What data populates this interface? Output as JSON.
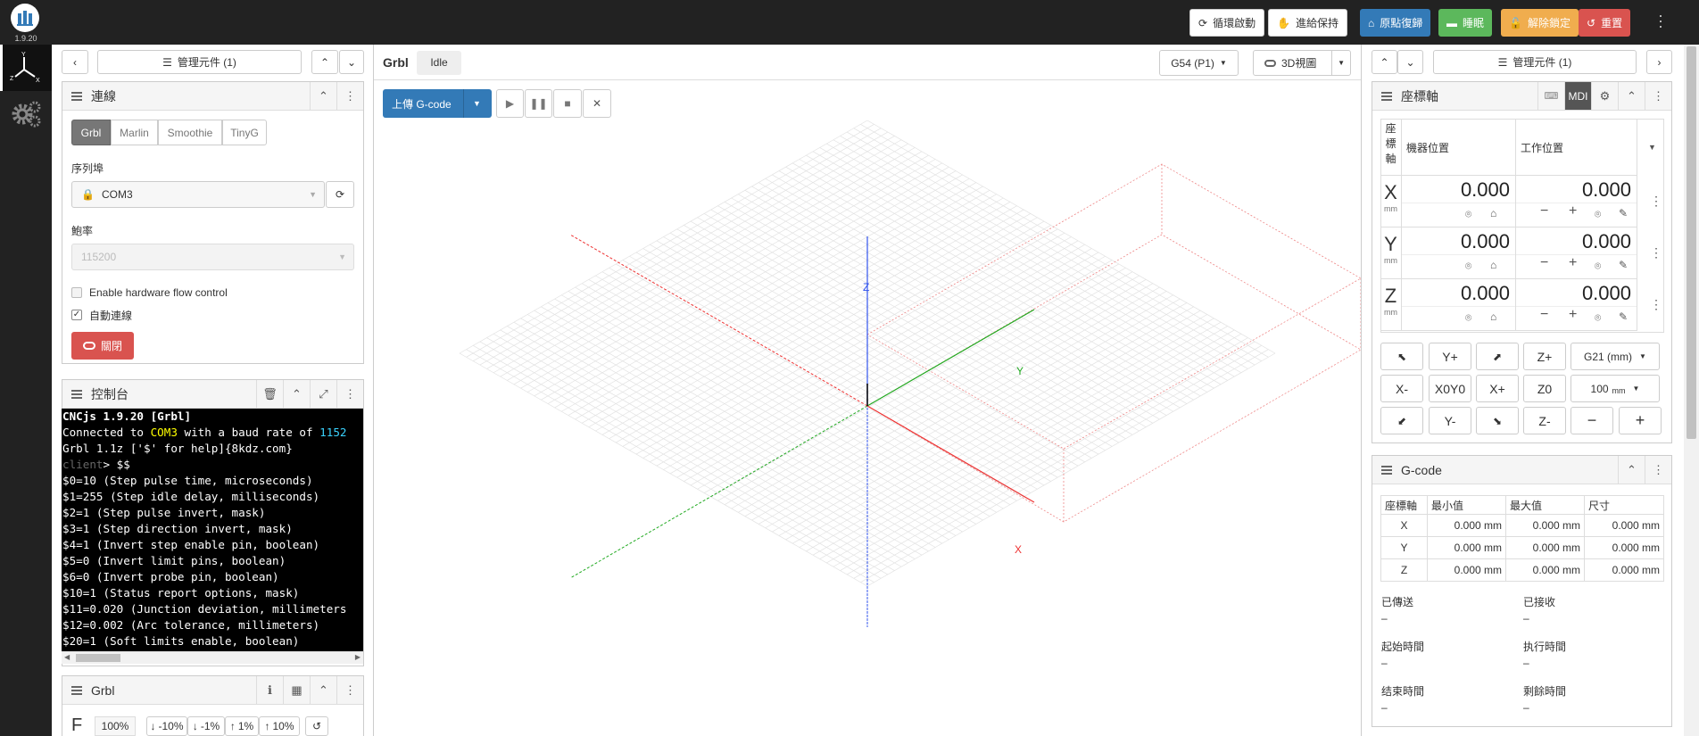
{
  "app": {
    "version": "1.9.20"
  },
  "topbar": {
    "cycle_start": "循環啟動",
    "feed_hold": "進給保持",
    "homing": "原點復歸",
    "sleep": "睡眠",
    "unlock": "解除鎖定",
    "reset": "重置"
  },
  "colors": {
    "blue": "#337ab7",
    "green": "#5cb85c",
    "orange": "#f0ad4e",
    "red": "#d9534f",
    "dark": "#222222"
  },
  "left": {
    "manage_widgets": "管理元件 (1)",
    "connection": {
      "title": "連線",
      "tabs": [
        "Grbl",
        "Marlin",
        "Smoothie",
        "TinyG"
      ],
      "port_label": "序列埠",
      "port_value": "COM3",
      "baud_label": "鮑率",
      "baud_value": "115200",
      "flow_control": "Enable hardware flow control",
      "auto_connect": "自動連線",
      "close_button": "關閉"
    },
    "console": {
      "title": "控制台",
      "lines": [
        "CNCjs 1.9.20 [Grbl]",
        "Connected to ",
        "COM3",
        " with a baud rate of ",
        "1152",
        "Grbl 1.1z ['$' for help]{8kdz.com}",
        "client",
        "> $$",
        "$0=10 (Step pulse time, microseconds)",
        "$1=255 (Step idle delay, milliseconds)",
        "$2=1 (Step pulse invert, mask)",
        "$3=1 (Step direction invert, mask)",
        "$4=1 (Invert step enable pin, boolean)",
        "$5=0 (Invert limit pins, boolean)",
        "$6=0 (Invert probe pin, boolean)",
        "$10=1 (Status report options, mask)",
        "$11=0.020 (Junction deviation, millimeters",
        "$12=0.002 (Arc tolerance, millimeters)",
        "$20=1 (Soft limits enable, boolean)"
      ]
    },
    "grbl": {
      "title": "Grbl",
      "feed_label": "F",
      "feed_value": "100%",
      "steps": [
        "-10%",
        "-1%",
        "1%",
        "10%"
      ]
    }
  },
  "center": {
    "controller": "Grbl",
    "state": "Idle",
    "wcs": "G54 (P1)",
    "view": "3D視圖",
    "upload": "上傳 G-code",
    "axis_labels": {
      "x": "X",
      "y": "Y",
      "z": "Z"
    }
  },
  "right": {
    "manage_widgets": "管理元件 (1)",
    "axes_panel": {
      "title": "座標軸",
      "mdi": "MDI",
      "col_axis": "座標軸",
      "col_machine": "機器位置",
      "col_work": "工作位置",
      "rows": [
        {
          "axis": "X",
          "unit": "mm",
          "machine": "0.000",
          "work": "0.000"
        },
        {
          "axis": "Y",
          "unit": "mm",
          "machine": "0.000",
          "work": "0.000"
        },
        {
          "axis": "Z",
          "unit": "mm",
          "machine": "0.000",
          "work": "0.000"
        }
      ],
      "jog": {
        "yplus": "Y+",
        "zplus": "Z+",
        "units": "G21 (mm)",
        "xminus": "X-",
        "xy0": "X0Y0",
        "xplus": "X+",
        "z0": "Z0",
        "step": "100",
        "step_unit": "mm",
        "yminus": "Y-",
        "zminus": "Z-",
        "minus": "−",
        "plus": "+"
      }
    },
    "gcode": {
      "title": "G-code",
      "headers": [
        "座標軸",
        "最小值",
        "最大值",
        "尺寸"
      ],
      "rows": [
        {
          "axis": "X",
          "min": "0.000 mm",
          "max": "0.000 mm",
          "dim": "0.000 mm"
        },
        {
          "axis": "Y",
          "min": "0.000 mm",
          "max": "0.000 mm",
          "dim": "0.000 mm"
        },
        {
          "axis": "Z",
          "min": "0.000 mm",
          "max": "0.000 mm",
          "dim": "0.000 mm"
        }
      ],
      "sent_label": "已傳送",
      "sent_value": "–",
      "received_label": "已接收",
      "received_value": "–",
      "start_label": "起始時間",
      "start_value": "–",
      "elapsed_label": "执行時間",
      "elapsed_value": "–",
      "finish_label": "结束時間",
      "finish_value": "–",
      "remaining_label": "剩餘時間",
      "remaining_value": "–"
    }
  }
}
